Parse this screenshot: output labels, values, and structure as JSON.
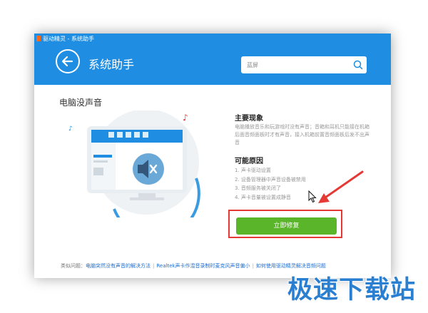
{
  "window": {
    "title": "驱动精灵 - 系统助手"
  },
  "header": {
    "title": "系统助手",
    "search": {
      "placeholder": "蓝屏"
    }
  },
  "main": {
    "title": "电脑没声音",
    "phenomenon": {
      "heading": "主要现象",
      "text": "电脑播放音乐和玩游戏时没有声音；音箱和耳机只能接在机箱后面音频面板时才有声音，接入机箱前置音频面板后发不出声音"
    },
    "causes": {
      "heading": "可能原因",
      "items": [
        "1. 声卡驱动设置",
        "2. 设备管理器中声音设备被禁用",
        "3. 音频服务被关闭了",
        "4. 声卡音量被设置成静音"
      ]
    },
    "fix_button": "立即修复"
  },
  "footer": {
    "prefix": "类似问题：",
    "links": [
      "电脑突然没有声音的解决方法",
      "Realtek声卡作混音录制时麦克风声音偏小",
      "如何使用驱动精灵解决音频问题"
    ],
    "separator": "|"
  },
  "watermark": "极速下载站",
  "colors": {
    "header": "#1f8ee2",
    "fix_button": "#5bb52a",
    "highlight": "#e53935",
    "link": "#1f6fd0"
  }
}
